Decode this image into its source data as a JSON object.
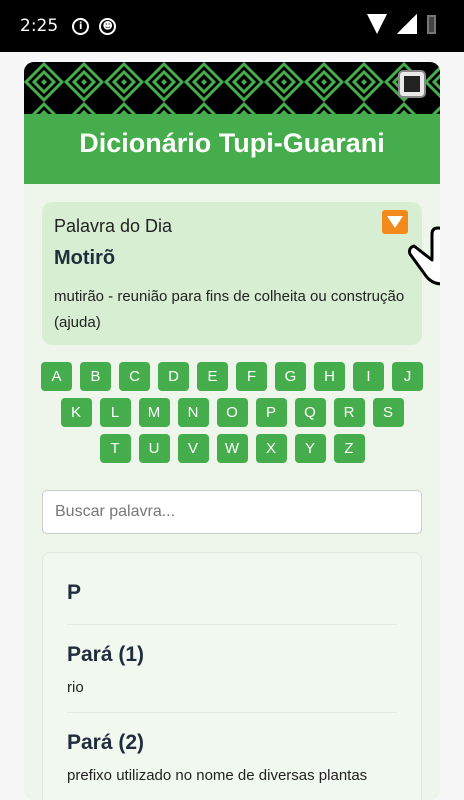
{
  "status_bar": {
    "time": "2:25",
    "icon_a": "i"
  },
  "header": {
    "title": "Dicionário Tupi-Guarani"
  },
  "word_of_day": {
    "label": "Palavra do Dia",
    "word": "Motirõ",
    "definition": "mutirão - reunião para fins de colheita ou construção (ajuda)"
  },
  "alphabet": {
    "row1": [
      "A",
      "B",
      "C",
      "D",
      "E",
      "F",
      "G",
      "H",
      "I",
      "J"
    ],
    "row2": [
      "K",
      "L",
      "M",
      "N",
      "O",
      "P",
      "Q",
      "R",
      "S"
    ],
    "row3": [
      "T",
      "U",
      "V",
      "W",
      "X",
      "Y",
      "Z"
    ]
  },
  "search": {
    "placeholder": "Buscar palavra..."
  },
  "results": {
    "letter": "P",
    "entries": [
      {
        "word": "Pará (1)",
        "definition": "rio"
      },
      {
        "word": "Pará (2)",
        "definition": "prefixo utilizado no nome de diversas plantas"
      }
    ]
  },
  "colors": {
    "primary": "#45ad4b",
    "accent": "#f28a1c",
    "card": "#d8eed3"
  }
}
